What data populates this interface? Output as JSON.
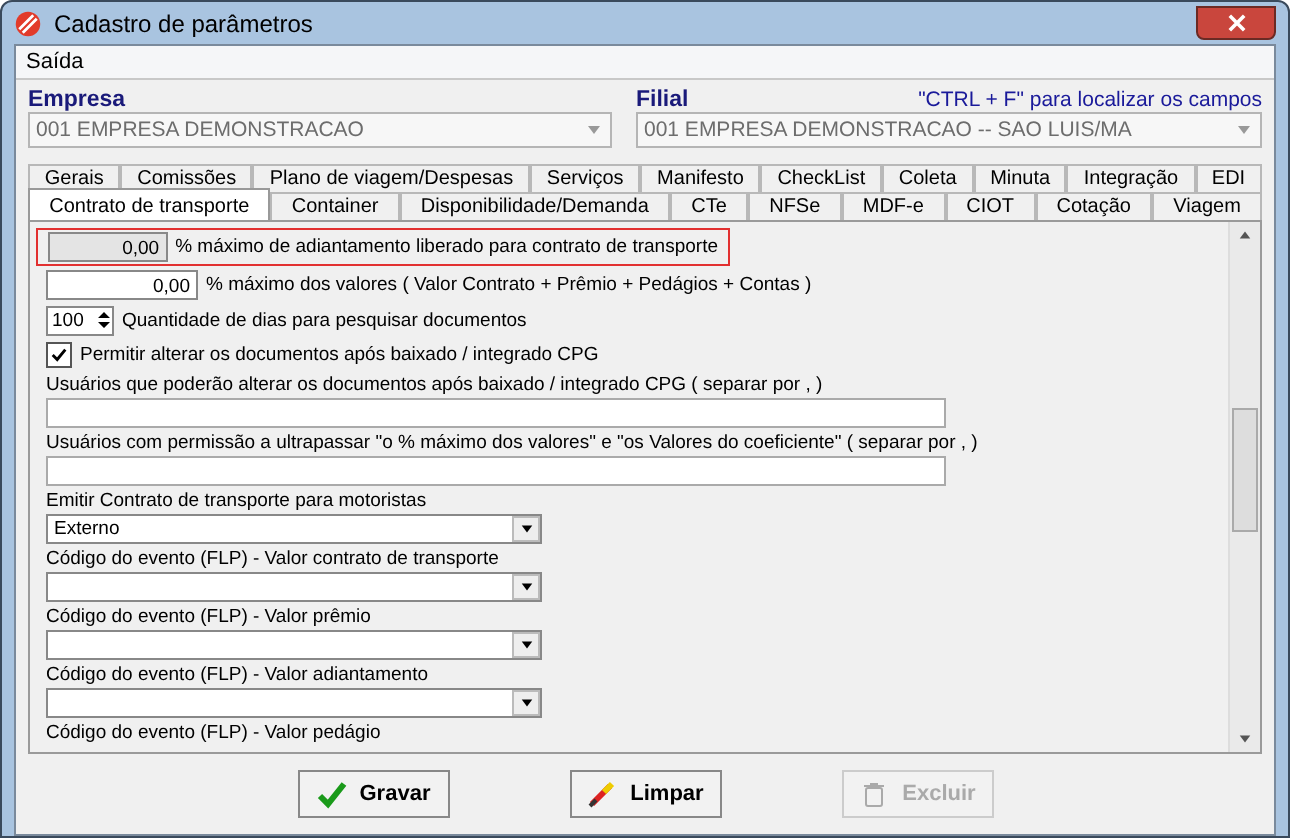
{
  "window": {
    "title": "Cadastro de parâmetros"
  },
  "menu": [
    "Saída"
  ],
  "empresa": {
    "label": "Empresa",
    "value": "001 EMPRESA DEMONSTRACAO",
    "disabled": true
  },
  "filial": {
    "label": "Filial",
    "value": "001 EMPRESA DEMONSTRACAO -- SAO LUIS/MA",
    "disabled": true,
    "hint": "\"CTRL + F\" para localizar os campos"
  },
  "tab_rows": [
    [
      {
        "label": "Gerais",
        "selected": false
      },
      {
        "label": "Comissões",
        "selected": false
      },
      {
        "label": "Plano de viagem/Despesas",
        "selected": false
      },
      {
        "label": "Serviços",
        "selected": false
      },
      {
        "label": "Manifesto",
        "selected": false
      },
      {
        "label": "CheckList",
        "selected": false
      },
      {
        "label": "Coleta",
        "selected": false
      },
      {
        "label": "Minuta",
        "selected": false
      },
      {
        "label": "Integração",
        "selected": false
      },
      {
        "label": "EDI",
        "selected": false
      }
    ],
    [
      {
        "label": "Contrato de transporte",
        "selected": true
      },
      {
        "label": "Container",
        "selected": false
      },
      {
        "label": "Disponibilidade/Demanda",
        "selected": false
      },
      {
        "label": "CTe",
        "selected": false
      },
      {
        "label": "NFSe",
        "selected": false
      },
      {
        "label": "MDF-e",
        "selected": false
      },
      {
        "label": "CIOT",
        "selected": false
      },
      {
        "label": "Cotação",
        "selected": false
      },
      {
        "label": "Viagem",
        "selected": false
      }
    ]
  ],
  "fields": [
    {
      "kind": "number",
      "value": "0,00",
      "label": "% máximo de adiantamento liberado para contrato de transporte",
      "disabled": true,
      "highlighted": true
    },
    {
      "kind": "number",
      "value": "0,00",
      "label": "% máximo dos valores ( Valor Contrato + Prêmio + Pedágios + Contas )",
      "disabled": false,
      "highlighted": false
    },
    {
      "kind": "spinner",
      "value": "100",
      "label": "Quantidade de dias para pesquisar documentos"
    },
    {
      "kind": "checkbox",
      "label": "Permitir alterar os documentos após baixado / integrado CPG",
      "checked": true
    },
    {
      "kind": "text",
      "label": "Usuários que poderão alterar os documentos após baixado / integrado CPG ( separar por , )"
    },
    {
      "kind": "text",
      "label": "Usuários com permissão a ultrapassar \"o % máximo dos valores\" e \"os Valores do coeficiente\"  ( separar por , )"
    },
    {
      "kind": "combo",
      "label": "Emitir Contrato de transporte para motoristas",
      "value": "Externo"
    },
    {
      "kind": "combo",
      "label": "Código do evento (FLP) - Valor contrato de transporte"
    },
    {
      "kind": "combo",
      "label": "Código do evento (FLP) - Valor prêmio"
    },
    {
      "kind": "combo",
      "label": "Código do evento (FLP) - Valor adiantamento"
    },
    {
      "kind": "label",
      "label": "Código do evento (FLP) - Valor pedágio"
    }
  ],
  "buttons": [
    {
      "label": "Gravar",
      "kind": "save",
      "disabled": false
    },
    {
      "label": "Limpar",
      "kind": "clear",
      "disabled": false
    },
    {
      "label": "Excluir",
      "kind": "delete",
      "disabled": true
    }
  ]
}
